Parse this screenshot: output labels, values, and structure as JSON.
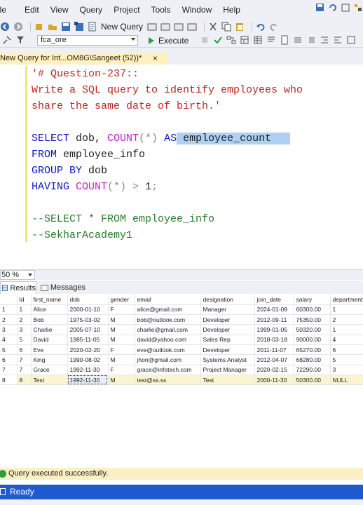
{
  "menu": [
    "ile",
    "Edit",
    "View",
    "Query",
    "Project",
    "Tools",
    "Window",
    "Help"
  ],
  "toolbar1": {
    "new_query_label": "New Query"
  },
  "toolbar2": {
    "database": "fca_ore",
    "execute_label": "Execute"
  },
  "tab": {
    "title": "New Query for Int...OM8G\\Sangeet (52))*",
    "close": "×"
  },
  "editor": {
    "l1": "'# Question-237::",
    "l2": "Write a SQL query to identify employees who",
    "l3": "share the same date of birth.'",
    "l4_kw1": "SELECT",
    "l4_t1": " dob, ",
    "l4_fn": "COUNT",
    "l4_p": "(*)",
    "l4_kw2": " AS",
    "l4_alias": " employee_count   ",
    "l5_kw": "FROM",
    "l5_t": " employee_info",
    "l6_kw": "GROUP BY",
    "l6_t": " dob",
    "l7_kw": "HAVING",
    "l7_fn": " COUNT",
    "l7_p": "(*)",
    "l7_op": " > ",
    "l7_t": "1",
    "l7_semi": ";",
    "l8": "--SELECT * FROM employee_info",
    "l9": "--SekharAcademy1"
  },
  "zoom": "50 %",
  "result_tabs": {
    "results": "Results",
    "messages": "Messages"
  },
  "grid": {
    "columns": [
      "",
      "Id",
      "first_name",
      "dob",
      "gender",
      "email",
      "designation",
      "join_date",
      "salary",
      "department"
    ],
    "rows": [
      [
        "1",
        "1",
        "Alice",
        "2000-01-10",
        "F",
        "alice@gmail.com",
        "Manager",
        "2024-01-09",
        "60300.00",
        "1"
      ],
      [
        "2",
        "2",
        "Bob",
        "1975-03-02",
        "M",
        "bob@outlook.com",
        "Developer",
        "2012-09-11",
        "75350.00",
        "2"
      ],
      [
        "3",
        "3",
        "Charlie",
        "2005-07-10",
        "M",
        "charlie@gmail.com",
        "Developer",
        "1999-01-05",
        "50320.00",
        "1"
      ],
      [
        "4",
        "5",
        "David",
        "1985-11-05",
        "M",
        "david@yahoo.com",
        "Sales Rep",
        "2018-03-18",
        "90000.00",
        "4"
      ],
      [
        "5",
        "6",
        "Eve",
        "2020-02-20",
        "F",
        "eve@outlook.com",
        "Developer",
        "2011-11-07",
        "65270.00",
        "6"
      ],
      [
        "6",
        "7",
        "King",
        "1990-08-02",
        "M",
        "jhon@gmail.com",
        "Systems Analyst",
        "2012-04-07",
        "68280.00",
        "5"
      ],
      [
        "7",
        "7",
        "Grace",
        "1992-11-30",
        "F",
        "grace@infotech.com",
        "Project Manager",
        "2020-02-15",
        "72290.00",
        "3"
      ],
      [
        "8",
        "8",
        "Test",
        "1992-11-30",
        "M",
        "test@ss.ss",
        "Test",
        "2000-11-30",
        "50300.00",
        "NULL"
      ]
    ]
  },
  "status": {
    "message": "Query executed successfully.",
    "ready": "Ready"
  }
}
